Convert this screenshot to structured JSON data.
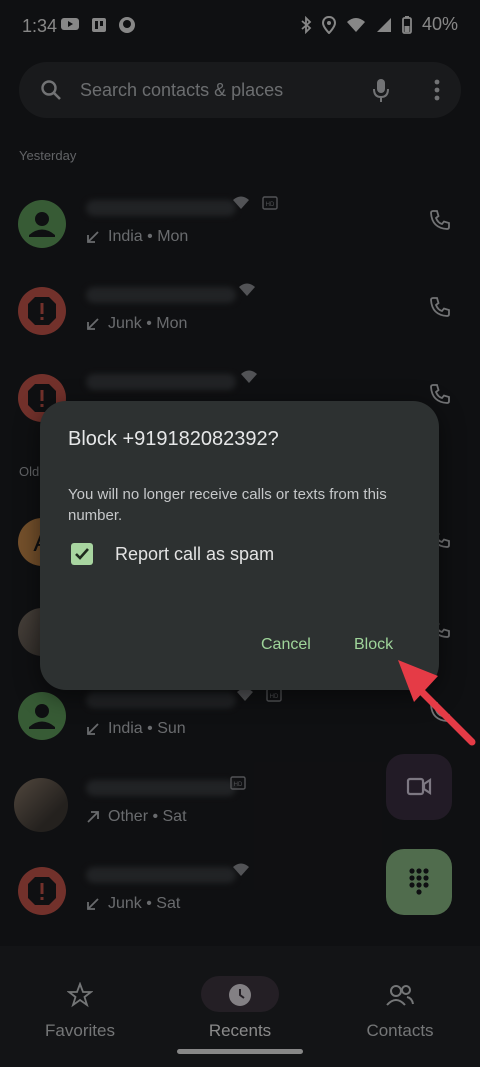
{
  "status": {
    "time": "1:34",
    "battery": "40%"
  },
  "search": {
    "placeholder": "Search contacts & places"
  },
  "sections": {
    "yesterday": "Yesterday",
    "older": "Old"
  },
  "calls": [
    {
      "subtitle": "India • Mon",
      "direction": "incoming",
      "avatar": "person-green"
    },
    {
      "subtitle": "Junk • Mon",
      "direction": "incoming",
      "avatar": "spam-red"
    },
    {
      "subtitle": "",
      "direction": "incoming",
      "avatar": "spam-red"
    },
    {
      "subtitle": "",
      "direction": "incoming",
      "avatar": "orange-letter",
      "letter": "A"
    },
    {
      "subtitle": "",
      "direction": "incoming",
      "avatar": "photo"
    },
    {
      "subtitle": "India • Sun",
      "direction": "incoming",
      "avatar": "person-green"
    },
    {
      "subtitle": "Other • Sat",
      "direction": "outgoing",
      "avatar": "photo"
    },
    {
      "subtitle": "Junk • Sat",
      "direction": "incoming",
      "avatar": "spam-red"
    }
  ],
  "dialog": {
    "title": "Block +919182082392?",
    "body": "You will no longer receive calls or texts from this number.",
    "checkbox_label": "Report call as spam",
    "checkbox_checked": true,
    "cancel": "Cancel",
    "block": "Block"
  },
  "nav": {
    "favorites": "Favorites",
    "recents": "Recents",
    "contacts": "Contacts"
  },
  "colors": {
    "background": "#1b1c1f",
    "accent_green": "#9fd59a",
    "spam_red": "#c4554b",
    "person_green": "#5f9d5c",
    "arrow_red": "#e53b46"
  }
}
